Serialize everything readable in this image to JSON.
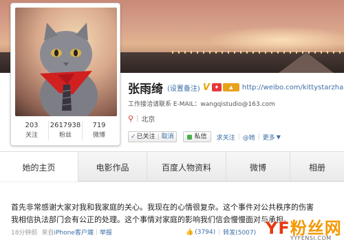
{
  "profile": {
    "name": "张雨绮",
    "remark_label": "(设置备注)",
    "verified_badge": "V",
    "vip_icon": "vip-badge-icon",
    "level_icon": "level-badge-icon",
    "homepage_url": "http://weibo.com/kittystarzhang",
    "work_contact": "工作接洽请联系 E-MAIL：wangqistudio@163.com",
    "location": "北京",
    "stats": [
      {
        "count": "203",
        "label": "关注"
      },
      {
        "count": "2617938",
        "label": "粉丝"
      },
      {
        "count": "719",
        "label": "微博"
      }
    ]
  },
  "actions": {
    "followed_label": "已关注",
    "cancel_label": "取消",
    "message_label": "私信",
    "request_follow_label": "求关注",
    "mention_label": "@她",
    "more_label": "更多"
  },
  "tabs": [
    {
      "label": "她的主页"
    },
    {
      "label": "电影作品"
    },
    {
      "label": "百度人物资料"
    },
    {
      "label": "微博"
    },
    {
      "label": "相册"
    }
  ],
  "post": {
    "line1": "首先非常感谢大家对我和我家庭的关心。我现在的心情很复杂。这个事件对公共秩序的伤害",
    "line2": "我相信执法部门会有公正的处理。这个事情对家庭的影响我们信会慢慢面对与承担。",
    "time": "18分钟前",
    "source_prefix": "来自",
    "source": "iPhone客户端",
    "report": "举报",
    "likes": "(3794)",
    "repost": "转发(5007)"
  },
  "watermark": {
    "logo": "YF粉丝网",
    "url": "YYFENSI.COM"
  },
  "colors": {
    "link": "#3a6ea5",
    "verified": "#e8a400",
    "watermark": "#f39800"
  }
}
